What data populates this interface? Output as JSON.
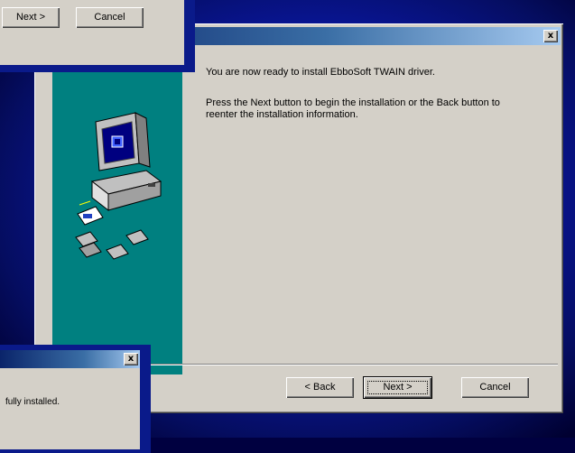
{
  "main_dialog": {
    "close_glyph": "x",
    "message_line1": "You are now ready to install EbboSoft TWAIN driver.",
    "message_line2": "Press the Next button to begin the installation or the Back button to reenter the installation information.",
    "back_label": "< Back",
    "next_label": "Next >",
    "cancel_label": "Cancel"
  },
  "top_fragment": {
    "next_label": "Next >",
    "cancel_label": "Cancel"
  },
  "bottom_fragment": {
    "close_glyph": "x",
    "text": "fully installed."
  }
}
